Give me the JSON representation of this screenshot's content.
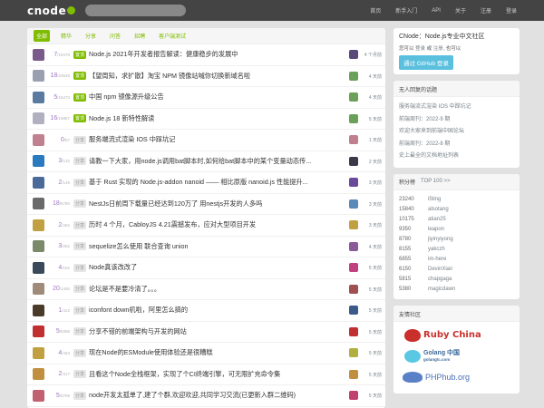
{
  "nav": {
    "logo": "cnode",
    "search_placeholder": "",
    "links": [
      "首页",
      "新手入门",
      "API",
      "关于",
      "注册",
      "登录"
    ]
  },
  "tabs": [
    "全部",
    "精华",
    "分享",
    "问答",
    "招聘",
    "客户端测试"
  ],
  "topics": [
    {
      "replies": "7",
      "views": "/19479",
      "badge": "置顶",
      "badge_type": "top",
      "title": "Node.js 2021年开发者报告解读：健康稳步的发展中",
      "ago": "4 个月前",
      "avatar_color": "#7a5a8a",
      "ravatar_color": "#5a4a7a"
    },
    {
      "replies": "18",
      "views": "/23548",
      "badge": "置顶",
      "badge_type": "top",
      "title": "【望周知，求扩散】淘宝 NPM 镜像站喊你切换新域名啦",
      "ago": "4 天前",
      "avatar_color": "#9aa0b0",
      "ravatar_color": "#6aa05a"
    },
    {
      "replies": "5",
      "views": "/16473",
      "badge": "置顶",
      "badge_type": "top",
      "title": "中国 npm 镜像源升级公告",
      "ago": "4 天前",
      "avatar_color": "#5a7aa0",
      "ravatar_color": "#6aa05a"
    },
    {
      "replies": "16",
      "views": "/15867",
      "badge": "置顶",
      "badge_type": "top",
      "title": "Node.js 18 新特性解读",
      "ago": "5 天前",
      "avatar_color": "#b0b0c0",
      "ravatar_color": "#6aa05a"
    },
    {
      "replies": "0",
      "views": "/87",
      "badge": "分享",
      "badge_type": "share",
      "title": "服务端流式渲染 IOS 中踩坑记",
      "ago": "1 天前",
      "avatar_color": "#c08090",
      "ravatar_color": "#c08090"
    },
    {
      "replies": "3",
      "views": "/132",
      "badge": "分享",
      "badge_type": "share",
      "title": "请教一下大家，用node.js调用bat脚本时,如何给bat脚本中的某个变量动态传...",
      "ago": "2 天前",
      "avatar_color": "#2a7ac0",
      "ravatar_color": "#3a3a4a"
    },
    {
      "replies": "2",
      "views": "/149",
      "badge": "分享",
      "badge_type": "share",
      "title": "基于 Rust 实现的 Node.js-addon nanoid —— 相比原版 nanoid.js 性能提升...",
      "ago": "3 天前",
      "avatar_color": "#4a6a9a",
      "ravatar_color": "#6a4a9a"
    },
    {
      "replies": "18",
      "views": "/6780",
      "badge": "分享",
      "badge_type": "share",
      "title": "NestJs日前周下载量已经达到120万了 用nestjs开发的人多吗",
      "ago": "3 天前",
      "avatar_color": "#6a6a6a",
      "ravatar_color": "#5a8aba"
    },
    {
      "replies": "2",
      "views": "/462",
      "badge": "分享",
      "badge_type": "share",
      "title": "历时 4 个月，CabloyJS 4.21震撼发布，应对大型项目开发",
      "ago": "3 天前",
      "avatar_color": "#c0a040",
      "ravatar_color": "#c0a040"
    },
    {
      "replies": "3",
      "views": "/282",
      "badge": "分享",
      "badge_type": "share",
      "title": "sequelize怎么使用 联合查询 union",
      "ago": "4 天前",
      "avatar_color": "#7a8a6a",
      "ravatar_color": "#8a5a9a"
    },
    {
      "replies": "4",
      "views": "/192",
      "badge": "分享",
      "badge_type": "share",
      "title": "Node真该改改了",
      "ago": "5 天前",
      "avatar_color": "#3a4a5a",
      "ravatar_color": "#c04080"
    },
    {
      "replies": "20",
      "views": "/1450",
      "badge": "分享",
      "badge_type": "share",
      "title": "论坛是不是要冷清了。。。",
      "ago": "5 天前",
      "avatar_color": "#a08a7a",
      "ravatar_color": "#a05050"
    },
    {
      "replies": "1",
      "views": "/422",
      "badge": "分享",
      "badge_type": "share",
      "title": "iconfont down机啦，阿里怎么搞的",
      "ago": "5 天前",
      "avatar_color": "#4a3a2a",
      "ravatar_color": "#3a5a8a"
    },
    {
      "replies": "5",
      "views": "/5398",
      "badge": "分享",
      "badge_type": "share",
      "title": "分享不错的前端架构与开发的网站",
      "ago": "5 天前",
      "avatar_color": "#c03030",
      "ravatar_color": "#c03030"
    },
    {
      "replies": "4",
      "views": "/483",
      "badge": "分享",
      "badge_type": "share",
      "title": "现在Node的ESModule使用体验还是很糟糕",
      "ago": "5 天前",
      "avatar_color": "#c0a040",
      "ravatar_color": "#b0b040"
    },
    {
      "replies": "2",
      "views": "/417",
      "badge": "分享",
      "badge_type": "share",
      "title": "且看这个Node全栈框架，实现了个CI终端引擎，可无限扩充命令集",
      "ago": "5 天前",
      "avatar_color": "#c09040",
      "ravatar_color": "#c09040"
    },
    {
      "replies": "5",
      "views": "/6789",
      "badge": "分享",
      "badge_type": "share",
      "title": "node开发太孤单了,建了个群,欢迎欢迎,共同学习交流(已更新入群二维码)",
      "ago": "5 天前",
      "avatar_color": "#c06070",
      "ravatar_color": "#c04070"
    }
  ],
  "sidebar": {
    "intro_title": "CNode：Node.js专业中文社区",
    "login_pre": "您可以",
    "login_link": "登录",
    "login_mid": "或",
    "register_link": "注册",
    "login_post": ", 也可以",
    "github_btn": "通过 GitHub 登录",
    "noreply_head": "无人回复的话题",
    "noreply_items": [
      "服务端流式渲染 IOS 中踩坑记",
      "前端周刊：2022-9 期",
      "欢迎大家来到前端中国论坛",
      "前端周刊：2022-8 期",
      "史上最全的文档地址列表"
    ],
    "top_head": "积分榜",
    "top_more": "TOP 100 >>",
    "ranking": [
      {
        "score": "23240",
        "name": "i5ting"
      },
      {
        "score": "15840",
        "name": "alsotang"
      },
      {
        "score": "10175",
        "name": "atian25"
      },
      {
        "score": "9350",
        "name": "leapon"
      },
      {
        "score": "8780",
        "name": "jiyinyiyong"
      },
      {
        "score": "8155",
        "name": "yakczh"
      },
      {
        "score": "6855",
        "name": "im-here"
      },
      {
        "score": "6150",
        "name": "DevinXian"
      },
      {
        "score": "5815",
        "name": "chapgaga"
      },
      {
        "score": "5380",
        "name": "magicdawn"
      }
    ],
    "friends_head": "友情社区",
    "friends": {
      "ruby": "Ruby China",
      "golang": "Golang 中国",
      "golang_sub": "golangtc.com",
      "php": "PHPhub.org"
    }
  }
}
